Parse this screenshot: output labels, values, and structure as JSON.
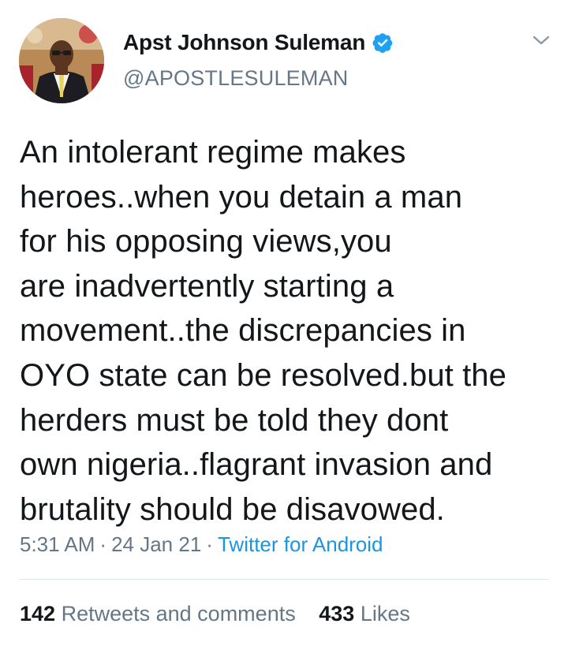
{
  "author": {
    "display_name": "Apst Johnson Suleman",
    "handle": "@APOSTLESULEMAN",
    "verified": true
  },
  "tweet": {
    "text_lines": [
      "An intolerant regime makes",
      "heroes..when you detain a man",
      "for his opposing views,you",
      "are inadvertently starting a",
      "movement..the discrepancies in",
      "OYO state can be resolved.but the",
      "herders must be told they dont",
      "own nigeria..flagrant invasion and",
      "brutality should be disavowed."
    ],
    "time": "5:31 AM",
    "date": "24 Jan 21",
    "separator": "·",
    "source": "Twitter for Android"
  },
  "stats": {
    "retweets_count": "142",
    "retweets_label": "Retweets and comments",
    "likes_count": "433",
    "likes_label": "Likes"
  },
  "icons": {
    "verified": "verified-badge-icon",
    "menu": "chevron-down-icon"
  },
  "colors": {
    "text_primary": "#14171a",
    "text_secondary": "#657786",
    "link": "#1b95e0",
    "verified": "#1da1f2",
    "divider": "#e1e8ed"
  }
}
